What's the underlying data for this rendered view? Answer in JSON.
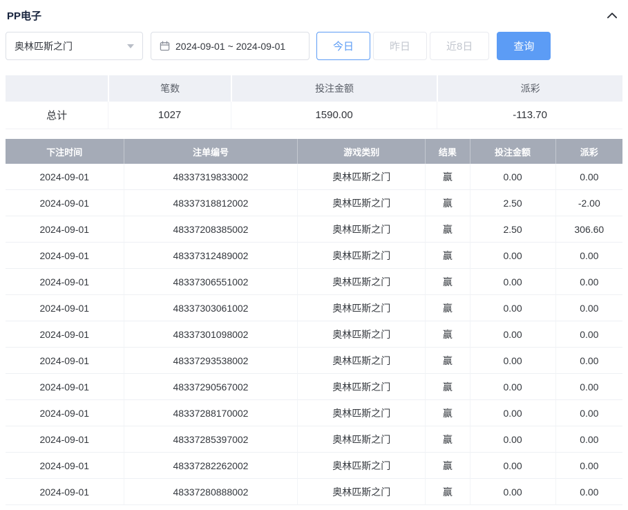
{
  "panel": {
    "title": "PP电子"
  },
  "filters": {
    "game_select": {
      "value": "奥林匹斯之门"
    },
    "date_range": {
      "value": "2024-09-01 ~ 2024-09-01"
    },
    "quick_buttons": [
      {
        "label": "今日",
        "active": true
      },
      {
        "label": "昨日",
        "active": false
      },
      {
        "label": "近8日",
        "active": false
      }
    ],
    "search_label": "查询"
  },
  "summary": {
    "headers": [
      "",
      "笔数",
      "投注金额",
      "派彩"
    ],
    "row_label": "总计",
    "count": "1027",
    "bet_amount": "1590.00",
    "payout": "-113.70"
  },
  "table": {
    "headers": [
      "下注时间",
      "注单编号",
      "游戏类别",
      "结果",
      "投注金额",
      "派彩"
    ],
    "rows": [
      [
        "2024-09-01",
        "48337319833002",
        "奥林匹斯之门",
        "赢",
        "0.00",
        "0.00"
      ],
      [
        "2024-09-01",
        "48337318812002",
        "奥林匹斯之门",
        "赢",
        "2.50",
        "-2.00"
      ],
      [
        "2024-09-01",
        "48337208385002",
        "奥林匹斯之门",
        "赢",
        "2.50",
        "306.60"
      ],
      [
        "2024-09-01",
        "48337312489002",
        "奥林匹斯之门",
        "赢",
        "0.00",
        "0.00"
      ],
      [
        "2024-09-01",
        "48337306551002",
        "奥林匹斯之门",
        "赢",
        "0.00",
        "0.00"
      ],
      [
        "2024-09-01",
        "48337303061002",
        "奥林匹斯之门",
        "赢",
        "0.00",
        "0.00"
      ],
      [
        "2024-09-01",
        "48337301098002",
        "奥林匹斯之门",
        "赢",
        "0.00",
        "0.00"
      ],
      [
        "2024-09-01",
        "48337293538002",
        "奥林匹斯之门",
        "赢",
        "0.00",
        "0.00"
      ],
      [
        "2024-09-01",
        "48337290567002",
        "奥林匹斯之门",
        "赢",
        "0.00",
        "0.00"
      ],
      [
        "2024-09-01",
        "48337288170002",
        "奥林匹斯之门",
        "赢",
        "0.00",
        "0.00"
      ],
      [
        "2024-09-01",
        "48337285397002",
        "奥林匹斯之门",
        "赢",
        "0.00",
        "0.00"
      ],
      [
        "2024-09-01",
        "48337282262002",
        "奥林匹斯之门",
        "赢",
        "0.00",
        "0.00"
      ],
      [
        "2024-09-01",
        "48337280888002",
        "奥林匹斯之门",
        "赢",
        "0.00",
        "0.00"
      ]
    ]
  },
  "colors": {
    "accent": "#5c9cf5",
    "negative": "#f25b5b",
    "table_header_bg": "#a5abb7"
  }
}
